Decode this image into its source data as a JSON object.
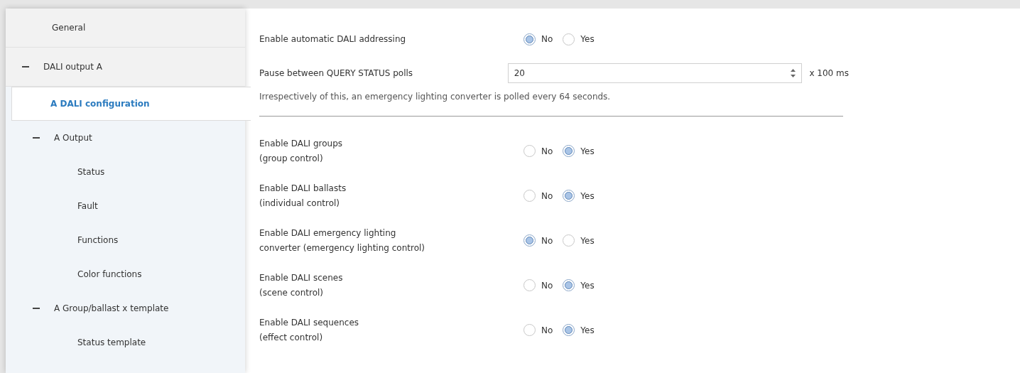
{
  "sidebar": {
    "items": [
      {
        "label": "General",
        "selected": false
      },
      {
        "label": "DALI output A",
        "selected": false,
        "expanded": true,
        "children": [
          {
            "label": "A DALI configuration",
            "selected": true
          },
          {
            "label": "A Output",
            "selected": false,
            "expanded": true,
            "children": [
              {
                "label": "Status",
                "selected": false
              },
              {
                "label": "Fault",
                "selected": false
              },
              {
                "label": "Functions",
                "selected": false
              },
              {
                "label": "Color functions",
                "selected": false
              }
            ]
          },
          {
            "label": "A Group/ballast x template",
            "selected": false,
            "expanded": true,
            "children": [
              {
                "label": "Status template",
                "selected": false
              }
            ]
          }
        ]
      }
    ]
  },
  "parameters": [
    {
      "kind": "radio",
      "label_lines": [
        "Enable automatic DALI addressing"
      ],
      "options": [
        {
          "label": "No",
          "selected": true
        },
        {
          "label": "Yes",
          "selected": false
        }
      ]
    },
    {
      "kind": "number",
      "label_lines": [
        "Pause between QUERY STATUS polls"
      ],
      "value": "20",
      "unit": "x 100 ms"
    },
    {
      "kind": "note",
      "text": "Irrespectively of this, an emergency lighting converter is polled every 64 seconds."
    },
    {
      "kind": "separator"
    },
    {
      "kind": "radio",
      "label_lines": [
        "Enable DALI groups",
        "(group control)"
      ],
      "options": [
        {
          "label": "No",
          "selected": false
        },
        {
          "label": "Yes",
          "selected": true
        }
      ]
    },
    {
      "kind": "radio",
      "label_lines": [
        "Enable DALI ballasts",
        "(individual control)"
      ],
      "options": [
        {
          "label": "No",
          "selected": false
        },
        {
          "label": "Yes",
          "selected": true
        }
      ]
    },
    {
      "kind": "radio",
      "label_lines": [
        "Enable DALI emergency lighting",
        "converter (emergency lighting control)"
      ],
      "options": [
        {
          "label": "No",
          "selected": true
        },
        {
          "label": "Yes",
          "selected": false
        }
      ]
    },
    {
      "kind": "radio",
      "label_lines": [
        "Enable DALI scenes",
        "(scene control)"
      ],
      "options": [
        {
          "label": "No",
          "selected": false
        },
        {
          "label": "Yes",
          "selected": true
        }
      ]
    },
    {
      "kind": "radio",
      "label_lines": [
        "Enable DALI sequences",
        "(effect control)"
      ],
      "options": [
        {
          "label": "No",
          "selected": false
        },
        {
          "label": "Yes",
          "selected": true
        }
      ]
    }
  ]
}
